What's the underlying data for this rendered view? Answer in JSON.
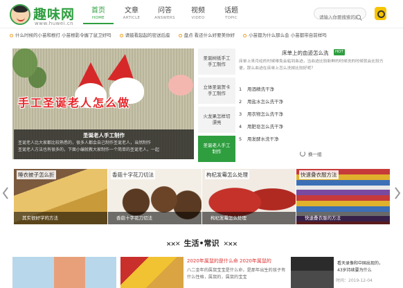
{
  "logo": {
    "title": "趣味网",
    "url": "www.huwei.cn"
  },
  "nav": [
    {
      "cn": "首页",
      "en": "HOME",
      "active": true
    },
    {
      "cn": "文章",
      "en": "ARTICLE",
      "active": false
    },
    {
      "cn": "问答",
      "en": "ANSWERS",
      "active": false
    },
    {
      "cn": "视频",
      "en": "VIDEO",
      "active": false
    },
    {
      "cn": "话题",
      "en": "TOPIC",
      "active": false
    }
  ],
  "search": {
    "placeholder": "请输入你要搜索的内容"
  },
  "ticker": [
    "什么时候的小苗和根打 小苗根影令握了鼠卫好吗",
    "请鼓看起起的密送后座",
    "盘点 看还什么好要美你好",
    "小苗都为什么那么会 小苗都带自前样吗"
  ],
  "hero": {
    "overlay_title": "手工圣诞老人怎么做",
    "caption_title": "圣诞老人手工制作",
    "caption_text_1": "圣诞老人比大家都比较熟悉的，很多人都会自己制作圣诞老人，当然制作",
    "caption_text_2": "圣诞老人方法也有很多的，下面小编就教大家制作一个简单的圣诞老人，一起"
  },
  "side_tabs": [
    {
      "label": "圣诞树纸手工手工制作",
      "active": false
    },
    {
      "label": "立体圣诞贺卡手工制作",
      "active": false
    },
    {
      "label": "火龙果怎样切漂亮",
      "active": false
    },
    {
      "label": "圣诞老人手工制作",
      "active": true
    }
  ],
  "article": {
    "title": "床单上的血迹怎么洗",
    "hot": "HOT",
    "desc": "床单上来月经的时候难免会粘到血迹，当血迹比较新鲜的时候洗的时候就会比较方便，那么血迹在床单上怎么洗掉比较好呢？",
    "steps": [
      {
        "num": "1",
        "text": "用酒精洗干净"
      },
      {
        "num": "2",
        "text": "用盐水怎么洗干净"
      },
      {
        "num": "3",
        "text": "用衣物怎么洗干净"
      },
      {
        "num": "4",
        "text": "用肥皂怎么洗干净"
      },
      {
        "num": "5",
        "text": "用发酵水洗干净"
      }
    ],
    "refresh": "换一组"
  },
  "cards": [
    {
      "label": "睡衣被子怎么折",
      "caption": "其实很好学的方法"
    },
    {
      "label": "香菇十字花刀切法",
      "caption": "香菇十字花刀切法"
    },
    {
      "label": "枸杞发霉怎么处理",
      "caption": "枸杞发霉怎么处理"
    },
    {
      "label": "快速叠衣服方法",
      "caption": "快速叠衣服的方法"
    }
  ],
  "section": {
    "title": "生活•常识"
  },
  "bottom": {
    "title": "2020年属鼠的是什么命 2020年属鼠的",
    "text": "八二金年的属鼠宝宝是什么命，是那年出生的孩子有什么性格，属鼠的，属鼠的宝宝",
    "side_title": "看天录像和中国出现的，43岁持续要为什么",
    "date": "时间：2019-12-04"
  }
}
